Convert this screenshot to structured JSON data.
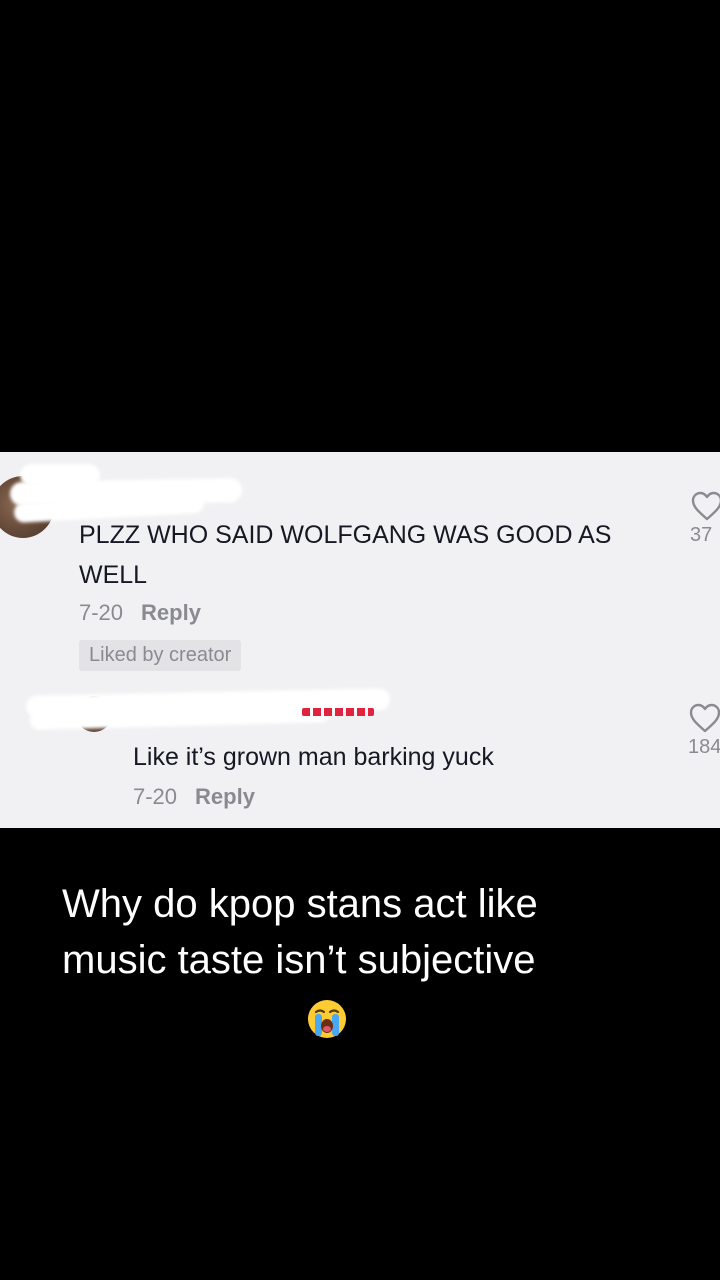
{
  "comments": [
    {
      "text": "PLZZ WHO SAID WOLFGANG WAS GOOD AS WELL",
      "date": "7-20",
      "reply_label": "Reply",
      "badge": "Liked by creator",
      "like_count": "37"
    },
    {
      "text": "Like it’s grown man barking yuck",
      "date": "7-20",
      "reply_label": "Reply",
      "like_count": "184"
    }
  ],
  "caption": {
    "line1": "Why do kpop stans act like",
    "line2": "music taste isn’t subjective",
    "emoji": "loudly-crying-face-icon"
  },
  "colors": {
    "background": "#000000",
    "panel": "#f1f1f3",
    "comment_text": "#161823",
    "muted_text": "#8a8b91",
    "caption_text": "#ffffff",
    "redaction": "#ffffff"
  }
}
